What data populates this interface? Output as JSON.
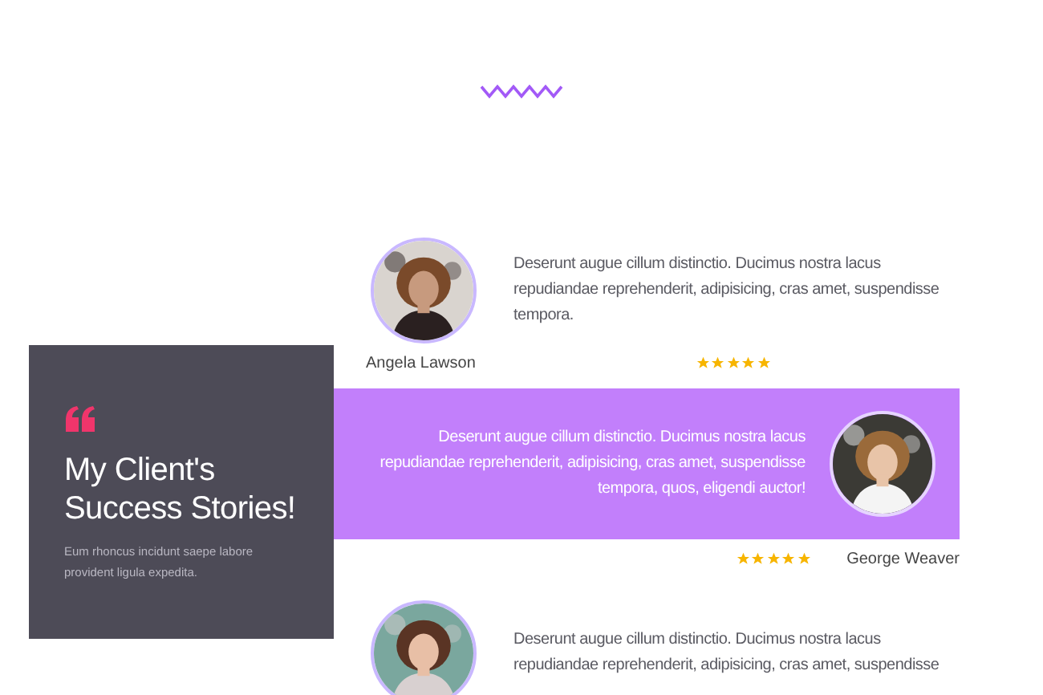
{
  "panel": {
    "title": "My Client's Success Stories!",
    "subtitle": "Eum rhoncus incidunt saepe labore provident ligula expedita."
  },
  "testimonials": [
    {
      "kind": "plain",
      "text": "Deserunt augue cillum distinctio. Ducimus nostra lacus repudiandae reprehenderit, adipisicing, cras amet, suspendisse tempora.",
      "name": "Angela Lawson",
      "stars": 5
    },
    {
      "kind": "highlight",
      "text": "Deserunt augue cillum distinctio. Ducimus nostra lacus repudiandae reprehenderit, adipisicing, cras amet, suspendisse tempora, quos, eligendi auctor!",
      "name": "George Weaver",
      "stars": 5
    },
    {
      "kind": "plain",
      "text": "Deserunt augue cillum distinctio. Ducimus nostra lacus repudiandae reprehenderit, adipisicing, cras amet, suspendisse"
    }
  ]
}
